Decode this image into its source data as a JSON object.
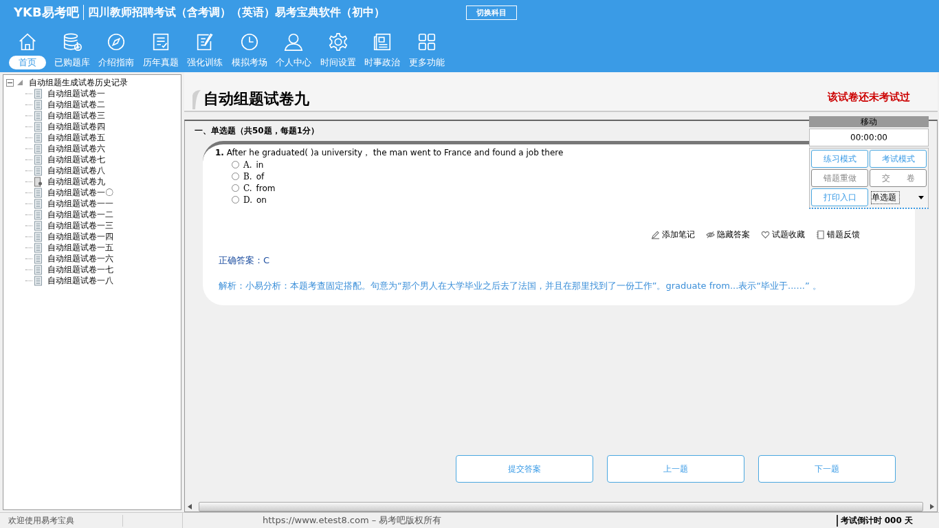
{
  "header": {
    "logo": "YKB易考吧",
    "title": "四川教师招聘考试（含考调）（英语）易考宝典软件（初中）",
    "switch_button": "切换科目"
  },
  "nav": [
    {
      "label": "首页",
      "selected": true
    },
    {
      "label": "已购题库",
      "selected": false
    },
    {
      "label": "介绍指南",
      "selected": false
    },
    {
      "label": "历年真题",
      "selected": false
    },
    {
      "label": "强化训练",
      "selected": false
    },
    {
      "label": "模拟考场",
      "selected": false
    },
    {
      "label": "个人中心",
      "selected": false
    },
    {
      "label": "时间设置",
      "selected": false
    },
    {
      "label": "时事政治",
      "selected": false
    },
    {
      "label": "更多功能",
      "selected": false
    }
  ],
  "tree": {
    "label": "自动组题生成试卷历史记录",
    "expanded": true,
    "children": [
      {
        "label": "自动组题试卷一",
        "kind": "paper"
      },
      {
        "label": "自动组题试卷二",
        "kind": "paper"
      },
      {
        "label": "自动组题试卷三",
        "kind": "paper"
      },
      {
        "label": "自动组题试卷四",
        "kind": "paper"
      },
      {
        "label": "自动组题试卷五",
        "kind": "paper"
      },
      {
        "label": "自动组题试卷六",
        "kind": "paper"
      },
      {
        "label": "自动组题试卷七",
        "kind": "paper"
      },
      {
        "label": "自动组题试卷八",
        "kind": "paper"
      },
      {
        "label": "自动组题试卷九",
        "kind": "current"
      },
      {
        "label": "自动组题试卷一〇",
        "kind": "paper"
      },
      {
        "label": "自动组题试卷一一",
        "kind": "paper"
      },
      {
        "label": "自动组题试卷一二",
        "kind": "paper"
      },
      {
        "label": "自动组题试卷一三",
        "kind": "paper"
      },
      {
        "label": "自动组题试卷一四",
        "kind": "paper"
      },
      {
        "label": "自动组题试卷一五",
        "kind": "paper"
      },
      {
        "label": "自动组题试卷一六",
        "kind": "paper"
      },
      {
        "label": "自动组题试卷一七",
        "kind": "paper"
      },
      {
        "label": "自动组题试卷一八",
        "kind": "paper"
      }
    ]
  },
  "paper": {
    "title": "自动组题试卷九",
    "status": "该试卷还未考试过",
    "section": "一、单选题（共50题，每题1分）"
  },
  "question": {
    "number": "1.",
    "text": "After he graduated(  )a university， the man went to France and found a job there",
    "options": [
      {
        "letter": "A.",
        "text": "in",
        "selected": false
      },
      {
        "letter": "B.",
        "text": "of",
        "selected": false
      },
      {
        "letter": "C.",
        "text": "from",
        "selected": false
      },
      {
        "letter": "D.",
        "text": "on",
        "selected": false
      }
    ],
    "tools": [
      "添加笔记",
      "隐藏答案",
      "试题收藏",
      "错题反馈"
    ],
    "answer": "正确答案：C",
    "analysis": "解析：小易分析：本题考查固定搭配。句意为“那个男人在大学毕业之后去了法国，并且在那里找到了一份工作”。graduate from...表示“毕业于......” 。"
  },
  "side_panel": {
    "move": "移动",
    "timer": "00:00:00",
    "buttons": [
      {
        "label": "练习模式",
        "kind": "blue"
      },
      {
        "label": "考试模式",
        "kind": "blue"
      },
      {
        "label": "错题重做",
        "kind": "grey"
      },
      {
        "label": "交　　卷",
        "kind": "grey"
      },
      {
        "label": "打印入口",
        "kind": "blue"
      }
    ],
    "type_select": "单选题"
  },
  "bottom_buttons": [
    "提交答案",
    "上一题",
    "下一题"
  ],
  "status_bar": {
    "welcome": "欢迎使用易考宝典",
    "copyright": "https://www.etest8.com – 易考吧版权所有",
    "countdown": "考试倒计时 000 天"
  }
}
